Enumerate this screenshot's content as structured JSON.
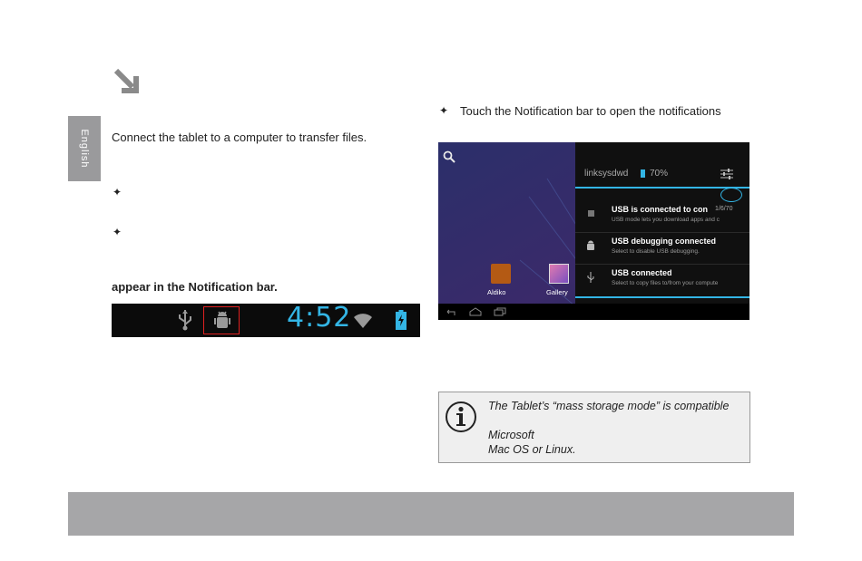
{
  "sidebar": {
    "language_tab": "English"
  },
  "left_column": {
    "intro": "Connect the tablet to a computer to transfer files.",
    "bullet_symbol": "✦",
    "bullet_1": "",
    "bullet_2": "",
    "bold_line": "appear in the Notification bar."
  },
  "status_bar": {
    "time": "4:52",
    "icons": [
      "usb-icon",
      "android-debug-icon",
      "wifi-icon",
      "battery-charging-icon"
    ],
    "highlight_color": "#e02020",
    "time_color": "#33b5e5"
  },
  "right_column": {
    "bullet_symbol": "✦",
    "instruction": "Touch the Notification bar to open the notifications"
  },
  "tablet_screen": {
    "network_name": "linksysdwd",
    "battery": "70%",
    "apps": [
      "Aldiko",
      "Gallery"
    ],
    "notifications": [
      {
        "title": "USB is connected to con",
        "time": "1/6/70",
        "subtitle": "USB mode lets you download apps and c"
      },
      {
        "title": "USB debugging connected",
        "time": "",
        "subtitle": "Select to disable USB debugging."
      },
      {
        "title": "USB connected",
        "time": "",
        "subtitle": "Select to copy files to/from your compute"
      }
    ]
  },
  "info_box": {
    "line_1": "The Tablet’s “mass storage mode” is compatible",
    "line_2": "Microsoft",
    "line_3": "Mac OS or Linux."
  },
  "colors": {
    "footer": "#a6a6a8",
    "sidebar_tab": "#9a9a9c",
    "accent": "#33b5e5"
  }
}
